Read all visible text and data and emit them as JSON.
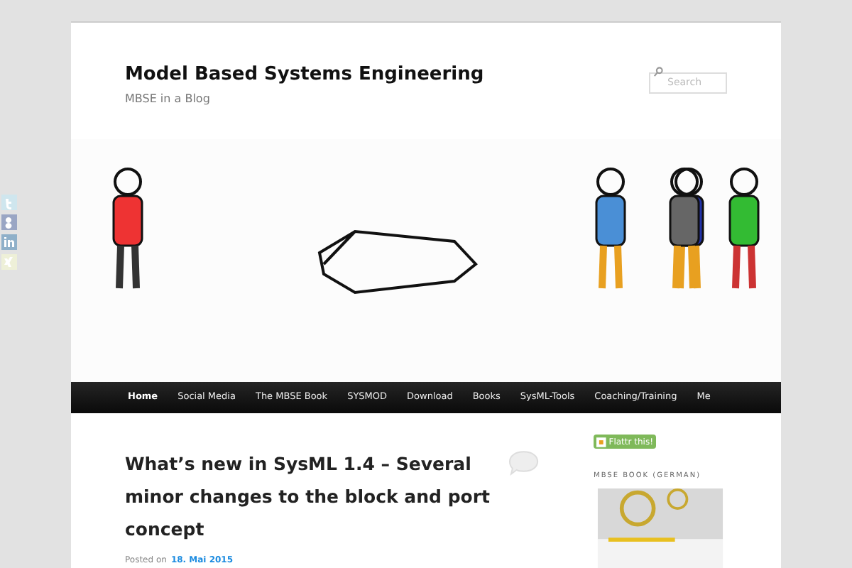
{
  "site": {
    "title": "Model Based Systems Engineering",
    "tagline": "MBSE in a Blog"
  },
  "search": {
    "placeholder": "Search"
  },
  "nav": [
    {
      "label": "Home",
      "selected": true
    },
    {
      "label": "Social Media",
      "selected": false
    },
    {
      "label": "The MBSE Book",
      "selected": false
    },
    {
      "label": "SYSMOD",
      "selected": false
    },
    {
      "label": "Download",
      "selected": false
    },
    {
      "label": "Books",
      "selected": false
    },
    {
      "label": "SysML-Tools",
      "selected": false
    },
    {
      "label": "Coaching/Training",
      "selected": false
    },
    {
      "label": "Me",
      "selected": false
    }
  ],
  "post": {
    "title": "What’s new in SysML 1.4 – Several minor changes to the block and port concept",
    "posted_label": "Posted on",
    "date": "18. Mai 2015"
  },
  "sidebar": {
    "flattr_button": "Flattr this!",
    "book_heading": "MBSE BOOK (GERMAN)"
  },
  "social_icons": [
    {
      "kind": "twitter"
    },
    {
      "kind": "google"
    },
    {
      "kind": "linkedin"
    },
    {
      "kind": "xing"
    }
  ]
}
